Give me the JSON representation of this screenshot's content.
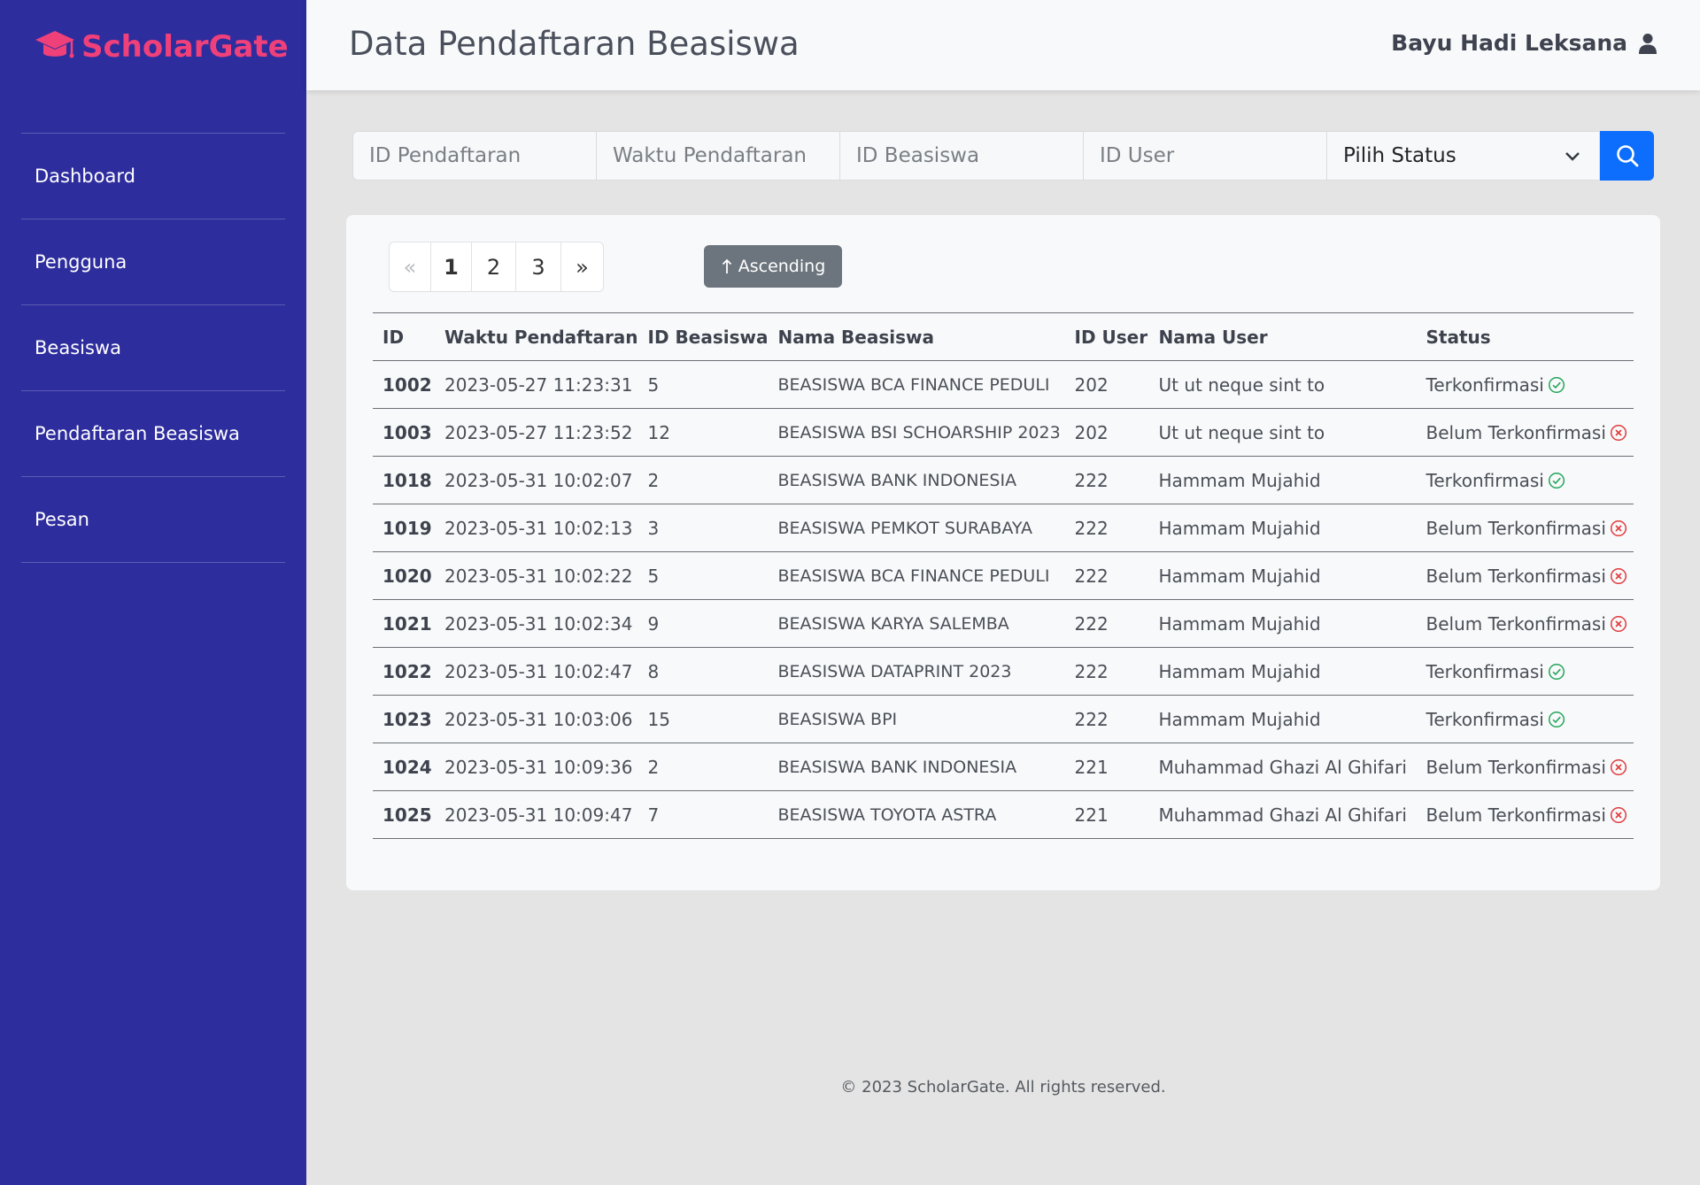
{
  "brand": {
    "name": "ScholarGate"
  },
  "sidebar": {
    "items": [
      {
        "label": "Dashboard"
      },
      {
        "label": "Pengguna"
      },
      {
        "label": "Beasiswa"
      },
      {
        "label": "Pendaftaran Beasiswa"
      },
      {
        "label": "Pesan"
      }
    ]
  },
  "header": {
    "title": "Data Pendaftaran Beasiswa",
    "user_name": "Bayu Hadi Leksana",
    "user_icon": "user-icon"
  },
  "filters": {
    "id_pendaftaran_placeholder": "ID Pendaftaran",
    "waktu_placeholder": "Waktu Pendaftaran",
    "id_beasiswa_placeholder": "ID Beasiswa",
    "id_user_placeholder": "ID User",
    "status_selected": "Pilih Status",
    "search_icon": "search-icon"
  },
  "pagination": {
    "prev": "«",
    "pages": [
      "1",
      "2",
      "3"
    ],
    "current": "1",
    "next": "»"
  },
  "sort_button": {
    "label": "Ascending",
    "icon": "arrow-up-icon"
  },
  "table": {
    "headers": [
      "ID",
      "Waktu Pendaftaran",
      "ID Beasiswa",
      "Nama Beasiswa",
      "ID User",
      "Nama User",
      "Status"
    ],
    "rows": [
      {
        "id": "1002",
        "waktu": "2023-05-27 11:23:31",
        "id_beasiswa": "5",
        "nama_beasiswa": "BEASISWA BCA FINANCE PEDULI",
        "id_user": "202",
        "nama_user": "Ut ut neque sint to",
        "status": "Terkonfirmasi",
        "confirmed": true
      },
      {
        "id": "1003",
        "waktu": "2023-05-27 11:23:52",
        "id_beasiswa": "12",
        "nama_beasiswa": "BEASISWA BSI SCHOARSHIP 2023",
        "id_user": "202",
        "nama_user": "Ut ut neque sint to",
        "status": "Belum Terkonfirmasi",
        "confirmed": false
      },
      {
        "id": "1018",
        "waktu": "2023-05-31 10:02:07",
        "id_beasiswa": "2",
        "nama_beasiswa": "BEASISWA BANK INDONESIA",
        "id_user": "222",
        "nama_user": "Hammam Mujahid",
        "status": "Terkonfirmasi",
        "confirmed": true
      },
      {
        "id": "1019",
        "waktu": "2023-05-31 10:02:13",
        "id_beasiswa": "3",
        "nama_beasiswa": "BEASISWA PEMKOT SURABAYA",
        "id_user": "222",
        "nama_user": "Hammam Mujahid",
        "status": "Belum Terkonfirmasi",
        "confirmed": false
      },
      {
        "id": "1020",
        "waktu": "2023-05-31 10:02:22",
        "id_beasiswa": "5",
        "nama_beasiswa": "BEASISWA BCA FINANCE PEDULI",
        "id_user": "222",
        "nama_user": "Hammam Mujahid",
        "status": "Belum Terkonfirmasi",
        "confirmed": false
      },
      {
        "id": "1021",
        "waktu": "2023-05-31 10:02:34",
        "id_beasiswa": "9",
        "nama_beasiswa": "BEASISWA KARYA SALEMBA",
        "id_user": "222",
        "nama_user": "Hammam Mujahid",
        "status": "Belum Terkonfirmasi",
        "confirmed": false
      },
      {
        "id": "1022",
        "waktu": "2023-05-31 10:02:47",
        "id_beasiswa": "8",
        "nama_beasiswa": "BEASISWA DATAPRINT 2023",
        "id_user": "222",
        "nama_user": "Hammam Mujahid",
        "status": "Terkonfirmasi",
        "confirmed": true
      },
      {
        "id": "1023",
        "waktu": "2023-05-31 10:03:06",
        "id_beasiswa": "15",
        "nama_beasiswa": "BEASISWA BPI",
        "id_user": "222",
        "nama_user": "Hammam Mujahid",
        "status": "Terkonfirmasi",
        "confirmed": true
      },
      {
        "id": "1024",
        "waktu": "2023-05-31 10:09:36",
        "id_beasiswa": "2",
        "nama_beasiswa": "BEASISWA BANK INDONESIA",
        "id_user": "221",
        "nama_user": "Muhammad Ghazi Al Ghifari",
        "status": "Belum Terkonfirmasi",
        "confirmed": false
      },
      {
        "id": "1025",
        "waktu": "2023-05-31 10:09:47",
        "id_beasiswa": "7",
        "nama_beasiswa": "BEASISWA TOYOTA ASTRA",
        "id_user": "221",
        "nama_user": "Muhammad Ghazi Al Ghifari",
        "status": "Belum Terkonfirmasi",
        "confirmed": false
      }
    ]
  },
  "footer": {
    "text": "© 2023 ScholarGate. All rights reserved."
  },
  "colors": {
    "sidebar_bg": "#2e2d9e",
    "brand": "#f0407a",
    "primary": "#0d6efd",
    "confirmed": "#23a55a",
    "unconfirmed": "#e03a3e",
    "sort_button": "#6c757d"
  }
}
